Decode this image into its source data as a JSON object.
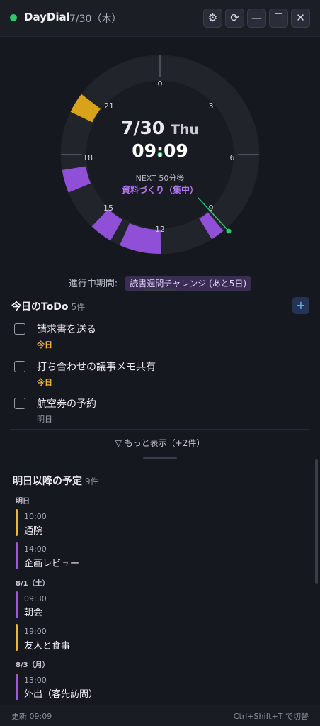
{
  "app": {
    "title": "DayDial",
    "date": "7/30（木）"
  },
  "titlebar": {
    "settings_icon": "gear-icon",
    "refresh_icon": "refresh-icon",
    "minimize_icon": "minimize-icon",
    "maximize_icon": "maximize-icon",
    "close_icon": "close-icon"
  },
  "dial": {
    "hour_labels": [
      "0",
      "3",
      "6",
      "9",
      "12",
      "15",
      "18",
      "21"
    ],
    "date": "7/30",
    "day_of_week": "Thu",
    "time": "09:09",
    "next_label": "NEXT 50分後",
    "next_event": "資料づくり（集中）",
    "colors": {
      "purple": "#8f4fd6",
      "yellow": "#d9a21b",
      "track": "#22242c",
      "now": "#2fc86a"
    }
  },
  "period": {
    "label": "進行中期間:",
    "tag": "読書週間チャレンジ (あと5日)"
  },
  "todo": {
    "title": "今日のToDo",
    "count": "5件",
    "add_label": "+",
    "items": [
      {
        "title": "請求書を送る",
        "due": "今日"
      },
      {
        "title": "打ち合わせの議事メモ共有",
        "due": "今日"
      },
      {
        "title": "航空券の予約",
        "due": "明日"
      }
    ],
    "show_more": "▽ もっと表示（+2件）"
  },
  "upcoming": {
    "title": "明日以降の予定",
    "count": "9件",
    "days": [
      {
        "label": "明日",
        "events": [
          {
            "time": "10:00",
            "title": "通院",
            "color": "#f2b233"
          },
          {
            "time": "14:00",
            "title": "企画レビュー",
            "color": "#9b59e0"
          }
        ]
      },
      {
        "label": "8/1（土）",
        "events": [
          {
            "time": "09:30",
            "title": "朝会",
            "color": "#9b59e0"
          },
          {
            "time": "19:00",
            "title": "友人と食事",
            "color": "#f2b233"
          }
        ]
      },
      {
        "label": "8/3（月）",
        "events": [
          {
            "time": "13:00",
            "title": "外出（客先訪問）",
            "color": "#9b59e0"
          }
        ]
      }
    ]
  },
  "footer": {
    "updated": "更新 09:09",
    "shortcut": "Ctrl+Shift+T で切替"
  }
}
